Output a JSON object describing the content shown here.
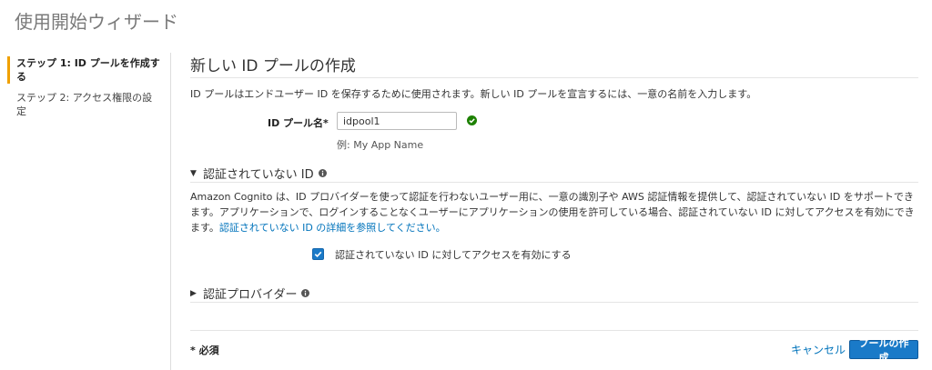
{
  "page": {
    "title": "使用開始ウィザード"
  },
  "sidebar": {
    "steps": [
      {
        "label": "ステップ 1: ID プールを作成する",
        "active": true
      },
      {
        "label": "ステップ 2: アクセス権限の設定",
        "active": false
      }
    ]
  },
  "main": {
    "section_title": "新しい ID プールの作成",
    "intro": "ID プールはエンドユーザー ID を保存するために使用されます。新しい ID プールを宣言するには、一意の名前を入力します。",
    "pool_name": {
      "label": "ID プール名*",
      "value": "idpool1",
      "hint": "例: My App Name"
    },
    "unauth": {
      "title": "認証されていない ID",
      "expanded": true,
      "description": "Amazon Cognito は、ID プロバイダーを使って認証を行わないユーザー用に、一意の識別子や AWS 認証情報を提供して、認証されていない ID をサポートできます。アプリケーションで、ログインすることなくユーザーにアプリケーションの使用を許可している場合、認証されていない ID に対してアクセスを有効にできます。",
      "link": "認証されていない ID の詳細を参照してください。",
      "checkbox_label": "認証されていない ID に対してアクセスを有効にする",
      "checkbox_checked": true
    },
    "providers": {
      "title": "認証プロバイダー",
      "expanded": false
    }
  },
  "footer": {
    "required_note": "* 必須",
    "cancel": "キャンセル",
    "create": "プールの作成"
  },
  "colors": {
    "accent": "#1a7ac8",
    "link": "#0073bb",
    "active_step": "#f0a000",
    "success": "#1d8102"
  }
}
